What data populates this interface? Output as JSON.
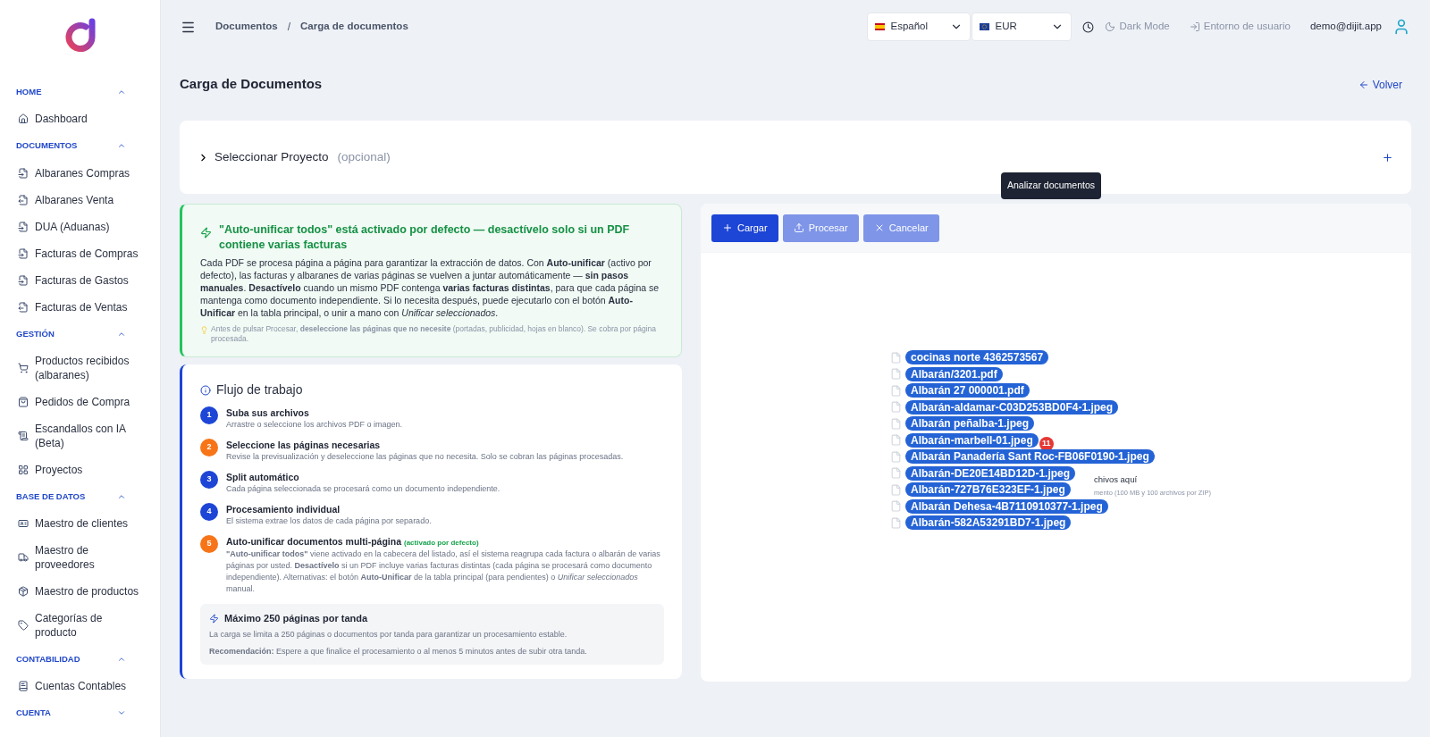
{
  "sidebar": {
    "sections": [
      {
        "title": "HOME",
        "expanded": true,
        "items": [
          {
            "label": "Dashboard"
          }
        ]
      },
      {
        "title": "DOCUMENTOS",
        "expanded": true,
        "items": [
          {
            "label": "Albaranes Compras"
          },
          {
            "label": "Albaranes Venta"
          },
          {
            "label": "DUA (Aduanas)"
          },
          {
            "label": "Facturas de Compras"
          },
          {
            "label": "Facturas de Gastos"
          },
          {
            "label": "Facturas de Ventas"
          }
        ]
      },
      {
        "title": "GESTIÓN",
        "expanded": true,
        "items": [
          {
            "label": "Productos recibidos (albaranes)"
          },
          {
            "label": "Pedidos de Compra"
          },
          {
            "label": "Escandallos con IA (Beta)"
          },
          {
            "label": "Proyectos"
          }
        ]
      },
      {
        "title": "BASE DE DATOS",
        "expanded": true,
        "items": [
          {
            "label": "Maestro de clientes"
          },
          {
            "label": "Maestro de proveedores"
          },
          {
            "label": "Maestro de productos"
          },
          {
            "label": "Categorías de producto"
          }
        ]
      },
      {
        "title": "CONTABILIDAD",
        "expanded": true,
        "items": [
          {
            "label": "Cuentas Contables"
          }
        ]
      },
      {
        "title": "CUENTA",
        "expanded": false
      }
    ]
  },
  "topbar": {
    "breadcrumbs": [
      "Documentos",
      "Carga de documentos"
    ],
    "separator": "/",
    "language": "Español",
    "currency": "EUR",
    "dark_mode": "Dark Mode",
    "user_environment": "Entorno de usuario",
    "user": "demo@dijit.app"
  },
  "page": {
    "title": "Carga de Documentos",
    "back": "Volver"
  },
  "project": {
    "label": "Seleccionar Proyecto",
    "hint": "(opcional)",
    "expanded": false
  },
  "notice": {
    "title": "\"Auto-unificar todos\" está activado por defecto — desactívelo solo si un PDF contiene varias facturas",
    "body": "Cada PDF se procesa página a página para garantizar la extracción de datos. Con **Auto-unificar** (activo por defecto), las facturas y albaranes de varias páginas se vuelven a juntar automáticamente — **sin pasos manuales**. **Desactívelo** cuando un mismo PDF contenga **varias facturas distintas**, para que cada página se mantenga como documento independiente. Si lo necesita después, puede ejecutarlo con el botón **Auto-Unificar** en la tabla principal, o unir a mano con *Unificar seleccionados*.",
    "tip": "Antes de pulsar Procesar, **deseleccione las páginas que no necesite** (portadas, publicidad, hojas en blanco). Se cobra por página procesada."
  },
  "workflow": {
    "title": "Flujo de trabajo",
    "steps": [
      {
        "number": "1",
        "color": "#1d45d6",
        "title": "Suba sus archivos",
        "description": "Arrastre o seleccione los archivos PDF o imagen."
      },
      {
        "number": "2",
        "color": "#f77518",
        "title": "Seleccione las páginas necesarias",
        "description": "Revise la previsualización y deseleccione las páginas que no necesita. Solo se cobran las páginas procesadas."
      },
      {
        "number": "3",
        "color": "#1d45d6",
        "title": "Split automático",
        "description": "Cada página seleccionada se procesará como un documento independiente."
      },
      {
        "number": "4",
        "color": "#1d45d6",
        "title": "Procesamiento individual",
        "description": "El sistema extrae los datos de cada página por separado."
      },
      {
        "number": "5",
        "color": "#f77518",
        "title": "Auto-unificar documentos multi-página",
        "tag": "(activado por defecto)",
        "description": "**\"Auto-unificar todos\"** viene activado en la cabecera del listado, así el sistema reagrupa cada factura o albarán de varias páginas por usted. **Desactívelo** si un PDF incluye varias facturas distintas (cada página se procesará como documento independiente). Alternativas: el botón **Auto-Unificar** de la tabla principal (para pendientes) o *Unificar seleccionados* manual."
      }
    ],
    "limit": {
      "title": "Máximo 250 páginas por tanda",
      "text": "La carga se limita a 250 páginas o documentos por tanda para garantizar un procesamiento estable.",
      "recommendation": "**Recomendación:** Espere a que finalice el procesamiento o al menos 5 minutos antes de subir otra tanda."
    }
  },
  "upload": {
    "buttons": [
      {
        "kind": "add",
        "label": "Cargar",
        "disabled": false
      },
      {
        "kind": "process",
        "label": "Procesar",
        "disabled": true
      },
      {
        "kind": "cancel",
        "label": "Cancelar",
        "disabled": true
      }
    ],
    "tooltip": "Analizar documentos",
    "drop_hint": [
      "chivos aquí",
      "mento (100 MB y 100 archivos por ZIP)"
    ],
    "dragged_count": "11",
    "dragged_files": [
      "cocinas norte 4362573567",
      "Albarán/3201.pdf",
      "Albarán 27 000001.pdf",
      "Albarán-aldamar-C03D253BD0F4-1.jpeg",
      "Albarán peñalba-1.jpeg",
      "Albarán-marbell-01.jpeg",
      "Albarán Panadería Sant Roc-FB06F0190-1.jpeg",
      "Albarán-DE20E14BD12D-1.jpeg",
      "Albarán-727B76E323EF-1.jpeg",
      "Albarán Dehesa-4B7110910377-1.jpeg",
      "Albarán-582A53291BD7-1.jpeg"
    ]
  }
}
